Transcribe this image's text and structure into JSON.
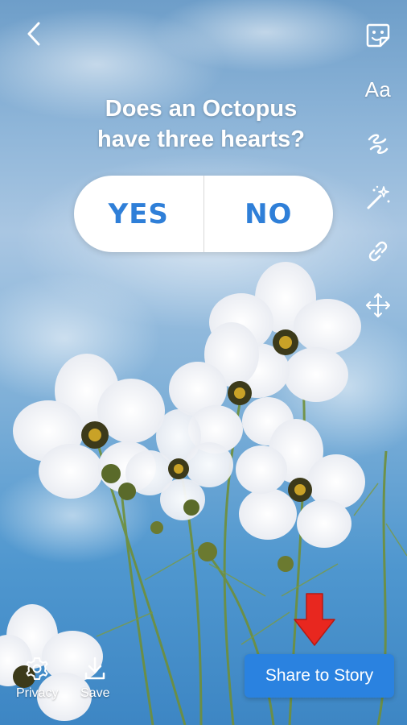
{
  "poll": {
    "question_line1": "Does an Octopus",
    "question_line2": "have three hearts?",
    "option_yes": "YES",
    "option_no": "NO"
  },
  "toolbar": {
    "icons": [
      "sticker-icon",
      "text-tool-icon",
      "draw-icon",
      "effects-wand-icon",
      "link-icon",
      "move-icon"
    ],
    "text_label": "Aa"
  },
  "bottom_bar": {
    "privacy_label": "Privacy",
    "save_label": "Save",
    "share_label": "Share to Story"
  },
  "colors": {
    "accent": "#2a82e0",
    "poll_text": "#2f7fd8",
    "annotation_arrow": "#e8271f"
  }
}
